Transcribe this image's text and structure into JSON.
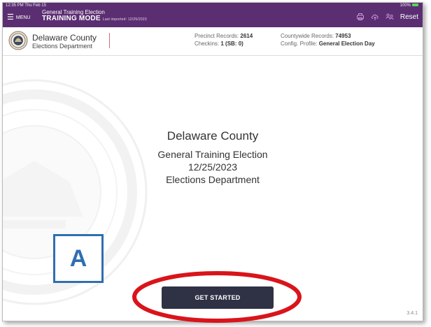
{
  "status_bar": {
    "time": "12:35 PM",
    "date": "Thu Feb 15",
    "battery_text": "100%"
  },
  "topbar": {
    "menu_label": "MENU",
    "election_name": "General Training Election",
    "mode": "TRAINING MODE",
    "imported": "Last imported: 12/25/2023",
    "reset_label": "Reset",
    "icons": [
      "printer-icon",
      "cloud-icon",
      "people-icon"
    ],
    "color": "#5b2e72"
  },
  "header": {
    "county": "Delaware County",
    "department": "Elections Department",
    "precinct_records_label": "Precinct Records:",
    "precinct_records_value": "2614",
    "checkins_label": "Checkins:",
    "checkins_value": "1 (SB: 0)",
    "countywide_records_label": "Countywide Records:",
    "countywide_records_value": "74953",
    "config_profile_label": "Config. Profile:",
    "config_profile_value": "General Election Day"
  },
  "main": {
    "county": "Delaware County",
    "election": "General Training Election",
    "date": "12/25/2023",
    "department": "Elections Department",
    "button_label": "GET STARTED",
    "button_color": "#2f3245",
    "version": "3.4.1"
  },
  "annotations": {
    "callout_label": "A",
    "callout_color": "#2f6fb0",
    "highlight_color": "#d9141b"
  }
}
